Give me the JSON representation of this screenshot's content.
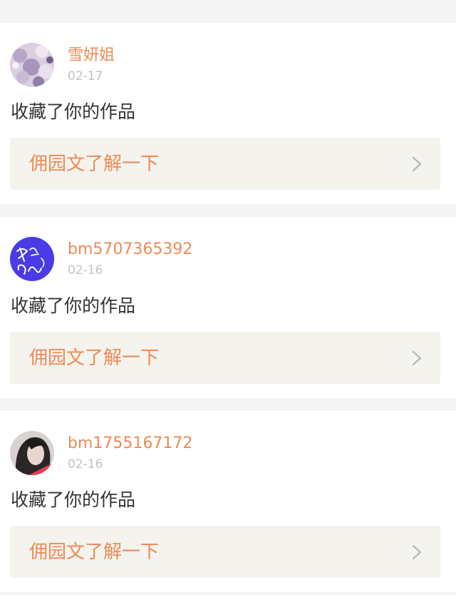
{
  "notifications": [
    {
      "username": "雪妍姐",
      "date": "02-17",
      "action": "收藏了你的作品",
      "work_title": "佣园文了解一下",
      "avatar_icon": "floral-photo-avatar"
    },
    {
      "username": "bm5707365392",
      "date": "02-16",
      "action": "收藏了你的作品",
      "work_title": "佣园文了解一下",
      "avatar_icon": "calligraphy-avatar"
    },
    {
      "username": "bm1755167172",
      "date": "02-16",
      "action": "收藏了你的作品",
      "work_title": "佣园文了解一下",
      "avatar_icon": "portrait-photo-avatar"
    }
  ],
  "colors": {
    "accent": "#ee8a55",
    "date": "#c2c2c2",
    "text": "#333333",
    "box": "#f4f3ee",
    "background": "#f4f4f4"
  }
}
